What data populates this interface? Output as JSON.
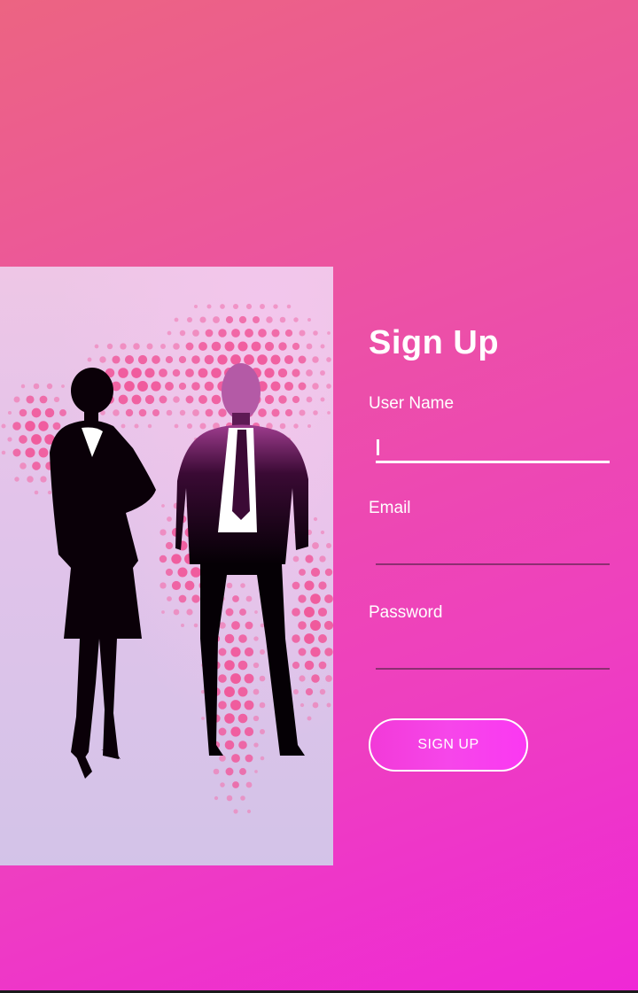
{
  "screen": {
    "title": "Sign Up"
  },
  "illustration": {
    "subject": "businesspeople-silhouette-image"
  },
  "form": {
    "username": {
      "label": "User Name",
      "value": "",
      "focused": true
    },
    "email": {
      "label": "Email",
      "value": ""
    },
    "password": {
      "label": "Password",
      "value": ""
    },
    "submit_label": "SIGN UP"
  },
  "colors": {
    "background_top": "#ec6482",
    "background_bottom": "#ef28d6",
    "button": "#f646ea",
    "underline": "#8d2f72",
    "text": "#ffffff"
  }
}
